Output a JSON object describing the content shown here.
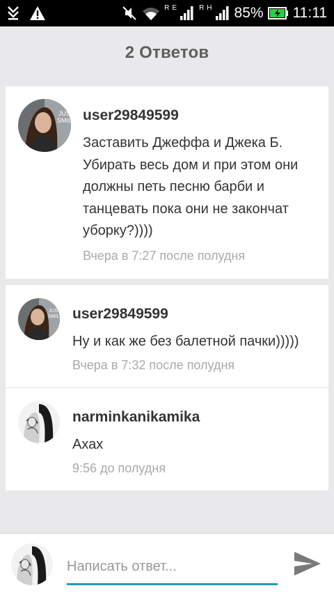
{
  "status_bar": {
    "roaming_1": "R",
    "roaming_1b": "E",
    "roaming_2": "R",
    "roaming_2b": "H",
    "battery": "85%",
    "time": "11:11"
  },
  "header": {
    "title": "2 Ответов"
  },
  "comment": {
    "username": "user29849599",
    "text": "Заставить Джеффа и Джека Б. Убирать весь дом и при этом они должны петь песню барби и танцевать пока они не закончат уборку?))))",
    "time": "Вчера в 7:27 после полудня"
  },
  "replies": [
    {
      "username": "user29849599",
      "text": "Ну и как же без балетной пачки)))))",
      "time": "Вчера в 7:32 после полудня"
    },
    {
      "username": "narminkanikamika",
      "text": "Ахах",
      "time": "9:56 до полудня"
    }
  ],
  "input": {
    "placeholder": "Написать ответ..."
  },
  "colors": {
    "accent": "#1c9bb8",
    "background": "#e9e8ea",
    "card": "#ffffff",
    "muted_text": "#aaaaaa"
  },
  "icons": [
    "download-icon",
    "warning-icon",
    "mute-icon",
    "wifi-icon",
    "signal-icon",
    "battery-charging-icon",
    "send-icon"
  ]
}
